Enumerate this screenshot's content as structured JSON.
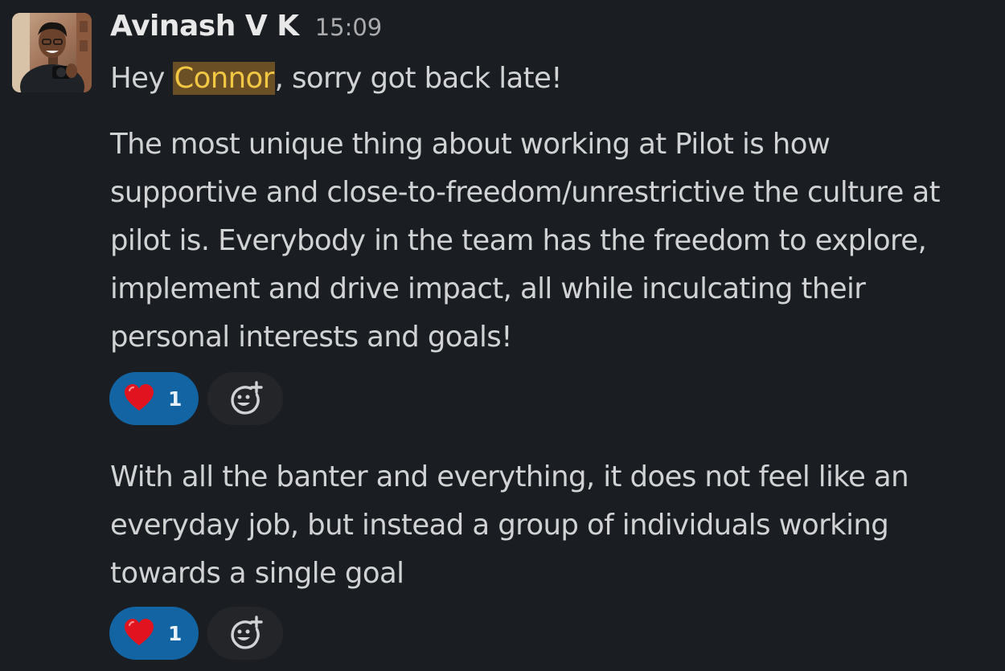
{
  "message": {
    "sender": "Avinash V K",
    "timestamp": "15:09",
    "greeting": {
      "before": "Hey ",
      "mention": "Connor",
      "after": ", sorry got back late!"
    },
    "paragraph1": [
      "The most unique thing about working at Pilot is how",
      "supportive and close-to-freedom/unrestrictive the culture at",
      "pilot is. Everybody in the team has the freedom to explore,",
      "implement and drive impact, all while inculcating their",
      "personal interests and goals!"
    ],
    "paragraph2": [
      "With all the banter and everything, it does not feel like an",
      "everyday job, but instead a group of individuals working",
      "towards a single goal"
    ],
    "reactions1": {
      "emoji": "heart-icon",
      "count": "1"
    },
    "reactions2": {
      "emoji": "heart-icon",
      "count": "1"
    }
  },
  "colors": {
    "background": "#1a1d21",
    "text": "#d1d2d3",
    "mention_bg": "#6b4f24",
    "mention_text": "#f2c744",
    "reaction_active": "#1264a3",
    "add_reaction_bg": "#232529"
  }
}
